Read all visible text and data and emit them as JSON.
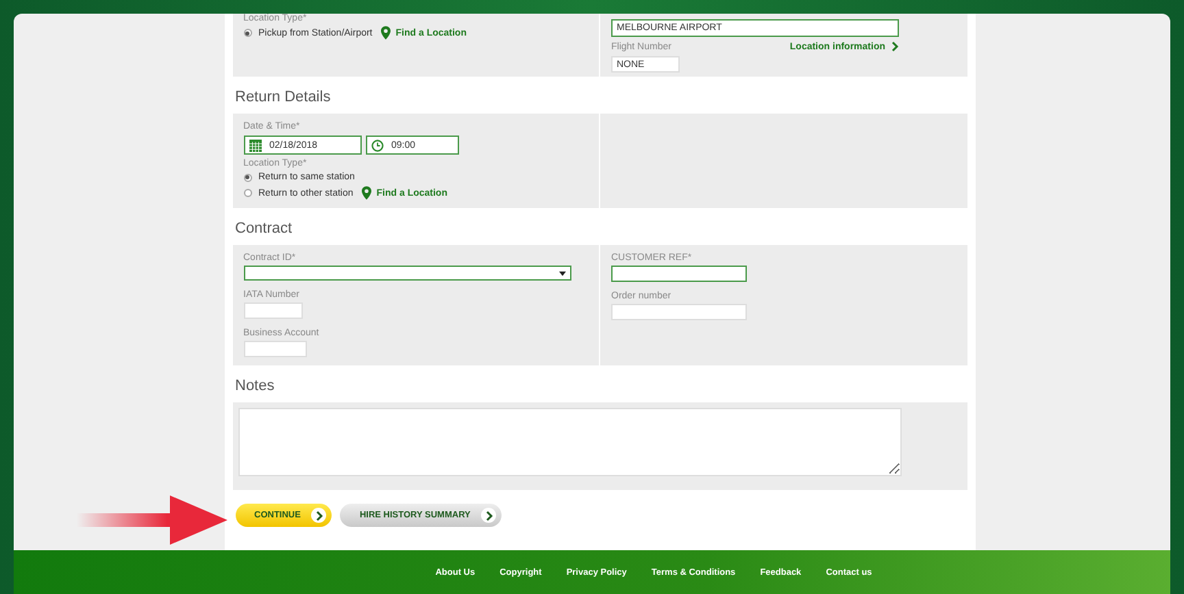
{
  "pickup": {
    "location_type_label": "Location Type*",
    "options": [
      {
        "label": "Pickup from Station/Airport",
        "selected": true
      }
    ],
    "find_link": "Find a Location",
    "station_value": "MELBOURNE AIRPORT",
    "flight_label": "Flight Number",
    "flight_value": "NONE",
    "location_info_link": "Location information"
  },
  "return": {
    "heading": "Return Details",
    "date_label": "Date & Time*",
    "date_value": "02/18/2018",
    "time_value": "09:00",
    "location_type_label": "Location Type*",
    "options": [
      {
        "label": "Return to same station",
        "selected": true
      },
      {
        "label": "Return to other station",
        "selected": false
      }
    ],
    "find_link": "Find a Location"
  },
  "contract": {
    "heading": "Contract",
    "contract_id_label": "Contract ID*",
    "iata_label": "IATA Number",
    "business_label": "Business Account",
    "customer_ref_label": "CUSTOMER REF*",
    "order_label": "Order number"
  },
  "notes": {
    "heading": "Notes"
  },
  "buttons": [
    {
      "label": "CONTINUE",
      "kind": "primary"
    },
    {
      "label": "HIRE HISTORY SUMMARY",
      "kind": "secondary"
    }
  ],
  "footer_links": [
    "About Us",
    "Copyright",
    "Privacy Policy",
    "Terms & Conditions",
    "Feedback",
    "Contact us"
  ]
}
